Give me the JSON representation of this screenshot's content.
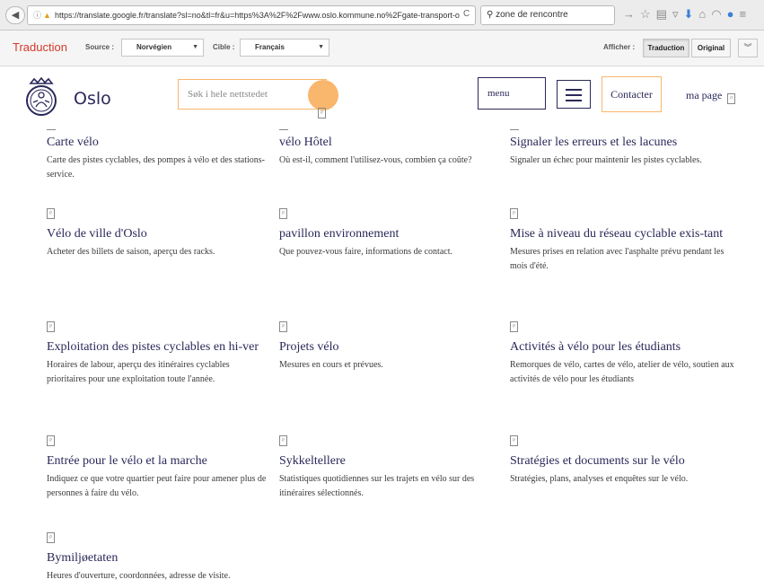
{
  "browser": {
    "url": "https://translate.google.fr/translate?sl=no&tl=fr&u=https%3A%2F%2Fwww.oslo.kommune.no%2Fgate-transport-o",
    "search_query": "zone de rencontre"
  },
  "translate_bar": {
    "title": "Traduction",
    "source_label": "Source :",
    "source_value": "Norvégien",
    "target_label": "Cible :",
    "target_value": "Français",
    "show_label": "Afficher :",
    "translation_button": "Traduction",
    "original_button": "Original"
  },
  "site": {
    "logo_text": "Oslo",
    "search_placeholder": "Søk i hele nettstedet",
    "menu_label": "menu",
    "contact_label": "Contacter",
    "my_page_label": "ma page",
    "image_placeholder": "⁉"
  },
  "cards": [
    {
      "title": "Carte vélo",
      "desc": "Carte des pistes cyclables, des pompes à vélo et des stations-service."
    },
    {
      "title": "vélo Hôtel",
      "desc": "Où est-il, comment l'utilisez-vous, combien ça coûte?"
    },
    {
      "title": "Signaler les erreurs et les lacunes",
      "desc": "Signaler un échec pour maintenir les pistes cyclables."
    },
    {
      "title": "Vélo de ville d'Oslo",
      "desc": "Acheter des billets de saison, aperçu des racks."
    },
    {
      "title": "pavillon environnement",
      "desc": "Que pouvez-vous faire, informations de contact."
    },
    {
      "title": "Mise à niveau du réseau cyclable exis-tant",
      "desc": "Mesures prises en relation avec l'asphalte prévu pendant les mois d'été."
    },
    {
      "title": "Exploitation des pistes cyclables en hi-ver",
      "desc": "Horaires de labour, aperçu des itinéraires cyclables prioritaires pour une exploitation toute l'année."
    },
    {
      "title": "Projets vélo",
      "desc": "Mesures en cours et prévues."
    },
    {
      "title": "Activités à vélo pour les étudiants",
      "desc": "Remorques de vélo, cartes de vélo, atelier de vélo, soutien aux activités de vélo pour les étudiants"
    },
    {
      "title": "Entrée pour le vélo et la marche",
      "desc": "Indiquez ce que votre quartier peut faire pour amener plus de personnes à faire du vélo."
    },
    {
      "title": "Sykkeltellere",
      "desc": "Statistiques quotidiennes sur les trajets en vélo sur des itinéraires sélectionnés."
    },
    {
      "title": "Stratégies et documents sur le vélo",
      "desc": "Stratégies, plans, analyses et enquêtes sur le vélo."
    },
    {
      "title": "Bymiljøetaten",
      "desc": "Heures d'ouverture, coordonnées, adresse de visite."
    }
  ],
  "colors": {
    "brand_navy": "#2a2859",
    "accent_orange": "#f9b66d",
    "translate_red": "#d43a2a"
  },
  "icons": [
    "back-arrow-icon",
    "info-icon",
    "security-warning-icon",
    "reload-icon",
    "search-icon",
    "bookmark-star-icon",
    "reading-list-icon",
    "pocket-icon",
    "download-icon",
    "home-icon",
    "extension-icon",
    "sync-icon",
    "hamburger-icon",
    "oslo-city-seal-icon",
    "broken-image-icon"
  ]
}
